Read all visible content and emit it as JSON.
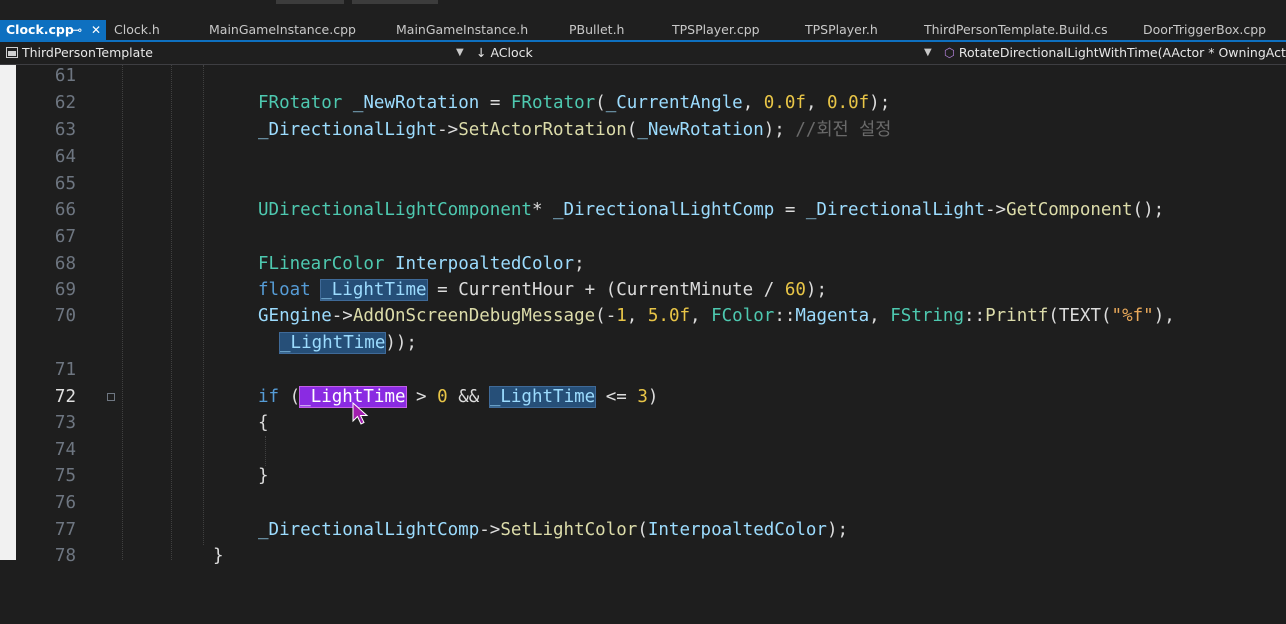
{
  "tabs": [
    {
      "label": "Clock.cpp",
      "active": true
    },
    {
      "label": "Clock.h"
    },
    {
      "label": "MainGameInstance.cpp"
    },
    {
      "label": "MainGameInstance.h"
    },
    {
      "label": "PBullet.h"
    },
    {
      "label": "TPSPlayer.cpp"
    },
    {
      "label": "TPSPlayer.h"
    },
    {
      "label": "ThirdPersonTemplate.Build.cs"
    },
    {
      "label": "DoorTriggerBox.cpp"
    }
  ],
  "tab_actions": {
    "pin": "⊸",
    "close": "✕"
  },
  "nav": {
    "project": "ThirdPersonTemplate",
    "scope": "AClock",
    "member": "RotateDirectionalLightWithTime(AActor * OwningActor)"
  },
  "lines": [
    {
      "n": "61"
    },
    {
      "n": "62"
    },
    {
      "n": "63"
    },
    {
      "n": "64"
    },
    {
      "n": "65"
    },
    {
      "n": "66"
    },
    {
      "n": "67"
    },
    {
      "n": "68"
    },
    {
      "n": "69"
    },
    {
      "n": "70"
    },
    {
      "n": ""
    },
    {
      "n": "71"
    },
    {
      "n": "72"
    },
    {
      "n": "73"
    },
    {
      "n": "74"
    },
    {
      "n": "75"
    },
    {
      "n": "76"
    },
    {
      "n": "77"
    },
    {
      "n": "78"
    }
  ],
  "code": {
    "l62": [
      "FRotator",
      " ",
      "_NewRotation",
      " = ",
      "FRotator",
      "(",
      "_CurrentAngle",
      ", ",
      "0.0f",
      ", ",
      "0.0f",
      ");"
    ],
    "l63": [
      "_DirectionalLight",
      "->",
      "SetActorRotation",
      "(",
      "_NewRotation",
      "); ",
      "//회전 설정"
    ],
    "l66": [
      "UDirectionalLightComponent",
      "* ",
      "_DirectionalLightComp",
      " = ",
      "_DirectionalLight",
      "->",
      "GetComponent",
      "();"
    ],
    "l68": [
      "FLinearColor",
      " ",
      "InterpoaltedColor",
      ";"
    ],
    "l69": [
      "float",
      " ",
      "_LightTime",
      " = CurrentHour + (CurrentMinute / ",
      "60",
      ");"
    ],
    "l70": [
      "GEngine",
      "->",
      "AddOnScreenDebugMessage",
      "(-",
      "1",
      ", ",
      "5.0f",
      ", ",
      "FColor",
      "::",
      "Magenta",
      ", ",
      "FString",
      "::",
      "Printf",
      "(TEXT(",
      "\"%f\"",
      "),"
    ],
    "l70b": [
      "_LightTime",
      "));"
    ],
    "l72": [
      "if",
      " (",
      "_LightTime",
      " > ",
      "0",
      " && ",
      "_LightTime",
      " <= ",
      "3",
      ")"
    ],
    "l73": [
      "{"
    ],
    "l75": [
      "}"
    ],
    "l77": [
      "_DirectionalLightComp",
      "->",
      "SetLightColor",
      "(",
      "InterpoaltedColor",
      ");"
    ],
    "l78": [
      "}"
    ]
  },
  "colors": {
    "accent": "#0e70c0",
    "highlight": "#8a2be2"
  }
}
